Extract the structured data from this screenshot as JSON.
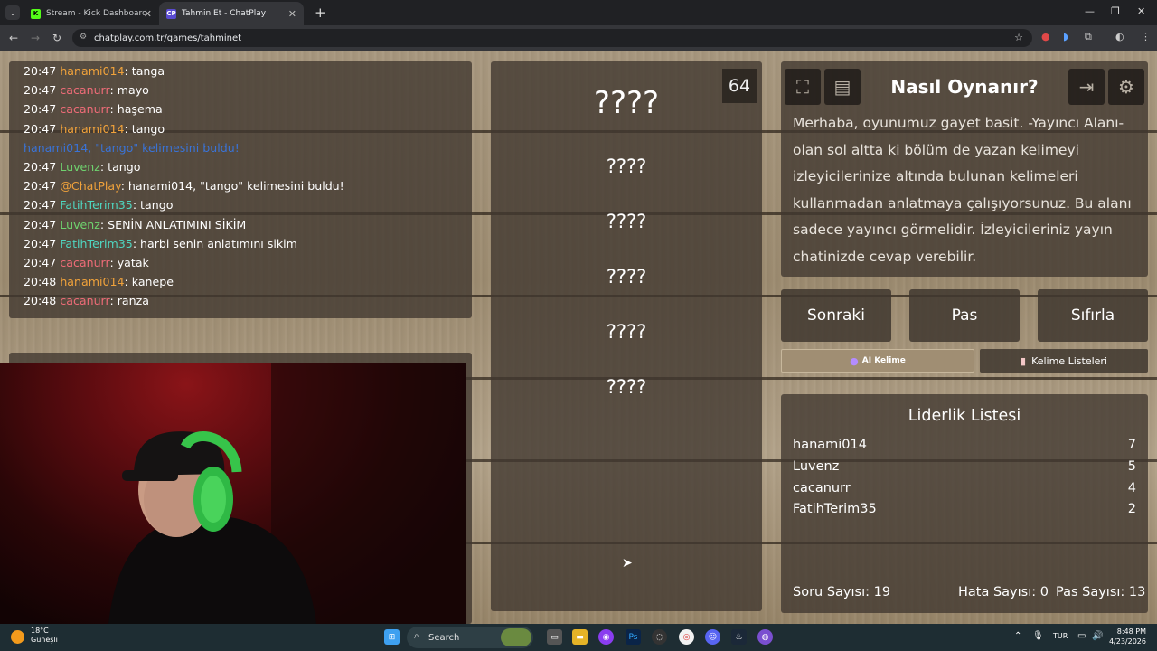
{
  "browser": {
    "tabs": [
      {
        "label": "Stream - Kick Dashboard",
        "active": false
      },
      {
        "label": "Tahmin Et - ChatPlay",
        "active": true
      }
    ],
    "url": "chatplay.com.tr/games/tahminet"
  },
  "chat": {
    "messages": [
      {
        "time": "20:47",
        "user": "hanami014",
        "text": ": tanga",
        "color": "orange"
      },
      {
        "time": "20:47",
        "user": "cacanurr",
        "text": ": mayo",
        "color": "red"
      },
      {
        "time": "20:47",
        "user": "cacanurr",
        "text": ": haşema",
        "color": "red"
      },
      {
        "time": "20:47",
        "user": "hanami014",
        "text": ": tango",
        "color": "orange"
      },
      {
        "time": "",
        "user": "",
        "text": "hanami014, \"tango\" kelimesini buldu!",
        "color": "blue"
      },
      {
        "time": "20:47",
        "user": "Luvenz",
        "text": ": tango",
        "color": "green"
      },
      {
        "time": "20:47",
        "user": "@ChatPlay",
        "text": ": hanami014, \"tango\" kelimesini buldu!",
        "color": "orange"
      },
      {
        "time": "20:47",
        "user": "FatihTerim35",
        "text": ": tango",
        "color": "cyan"
      },
      {
        "time": "20:47",
        "user": "Luvenz",
        "text": ": SENİN ANLATIMINI SİKİM",
        "color": "green"
      },
      {
        "time": "20:47",
        "user": "FatihTerim35",
        "text": ": harbi senin anlatımını sikim",
        "color": "cyan"
      },
      {
        "time": "20:47",
        "user": "cacanurr",
        "text": ": yatak",
        "color": "red"
      },
      {
        "time": "20:48",
        "user": "hanami014",
        "text": ": kanepe",
        "color": "orange"
      },
      {
        "time": "20:48",
        "user": "cacanurr",
        "text": ": ranza",
        "color": "red"
      }
    ]
  },
  "words": {
    "counter": "64",
    "main": "????",
    "list": [
      "????",
      "????",
      "????",
      "????",
      "????"
    ]
  },
  "info": {
    "title": "Nasıl Oynanır?",
    "body": "Merhaba, oyunumuz gayet basit. -Yayıncı Alanı- olan sol altta ki bölüm de yazan kelimeyi izleyicilerinize altında bulunan kelimeleri kullanmadan anlatmaya çalışıyorsunuz. Bu alanı sadece yayıncı görmelidir. İzleyicileriniz yayın chatinizde cevap verebilir.",
    "icons": [
      "fullscreen-icon",
      "notes-icon",
      "exit-icon",
      "gear-icon"
    ]
  },
  "actions": {
    "next": "Sonraki",
    "pass": "Pas",
    "reset": "Sıfırla",
    "ai_word": "AI Kelime",
    "word_lists": "Kelime Listeleri"
  },
  "leaderboard": {
    "title": "Liderlik Listesi",
    "rows": [
      {
        "name": "hanami014",
        "score": "7"
      },
      {
        "name": "Luvenz",
        "score": "5"
      },
      {
        "name": "cacanurr",
        "score": "4"
      },
      {
        "name": "FatihTerim35",
        "score": "2"
      }
    ],
    "question_count": "Soru Sayısı: 19",
    "error_count": "Hata Sayısı: 0",
    "pass_count": "Pas Sayısı: 13"
  },
  "taskbar": {
    "weather_temp": "18°C",
    "weather_desc": "Güneşli",
    "search": "Search",
    "lang": "TUR",
    "time": "8:48 PM",
    "date": "4/23/2026"
  }
}
